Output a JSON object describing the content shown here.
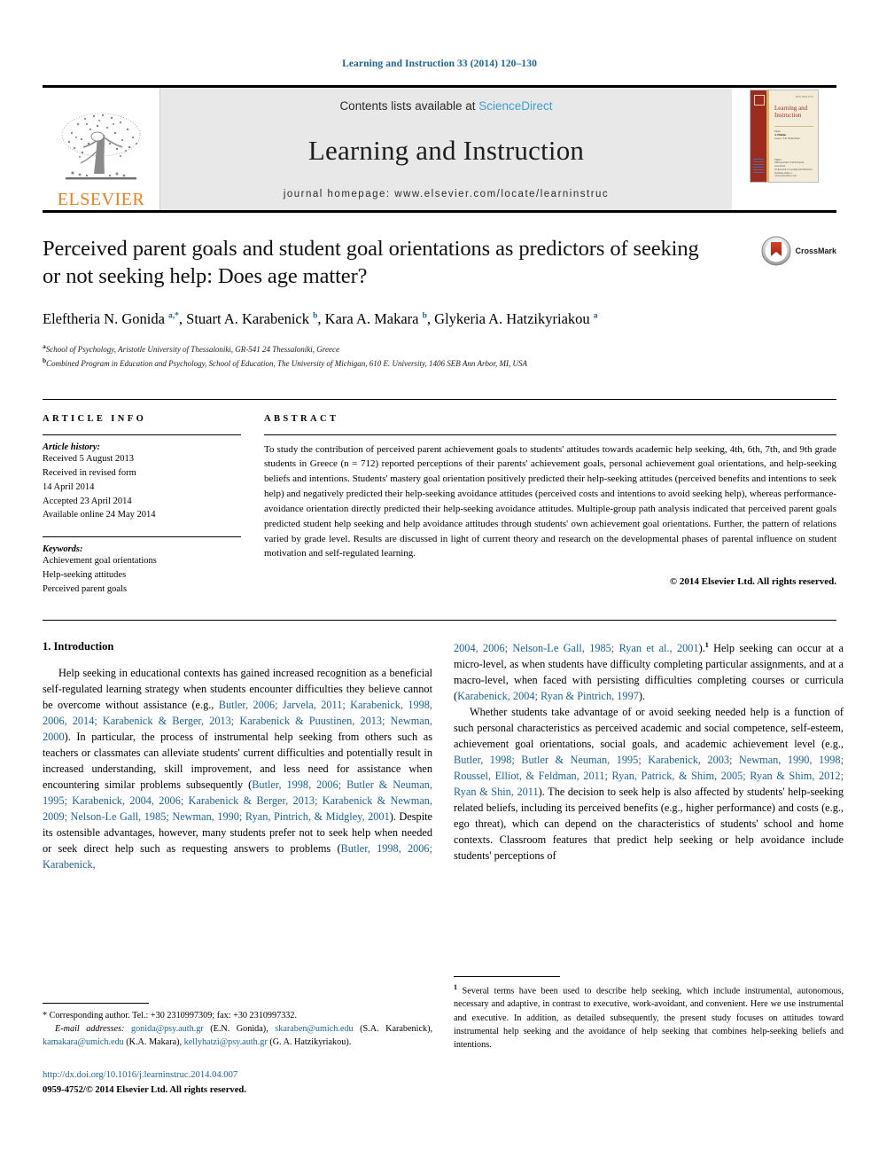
{
  "running_head": "Learning and Instruction 33 (2014) 120–130",
  "masthead": {
    "publisher_name": "ELSEVIER",
    "contents_prefix": "Contents lists available at ",
    "contents_link": "ScienceDirect",
    "journal_title": "Learning and Instruction",
    "homepage": "journal homepage: www.elsevier.com/locate/learninstruc",
    "cover": {
      "top_tiny": "ISSN 0959-4752",
      "name": "Learning and Instruction",
      "editor_label": "Editor",
      "editor_name": "A. Efklides",
      "editor_affil": "Greece / The Netherlands",
      "footer_lines": [
        "EARLI",
        "Official journal of the European Association",
        "for Research on Learning and Instruction",
        "Available online at www.sciencedirect.com"
      ]
    }
  },
  "article": {
    "title": "Perceived parent goals and student goal orientations as predictors of seeking or not seeking help: Does age matter?",
    "crossmark_label": "CrossMark",
    "authors_html": "Eleftheria N. Gonida <sup>a,*</sup>, Stuart A. Karabenick <sup>b</sup>, Kara A. Makara <sup>b</sup>, Glykeria A. Hatzikyriakou <sup>a</sup>",
    "affiliations": [
      {
        "marker": "a",
        "text": "School of Psychology, Aristotle University of Thessaloniki, GR-541 24 Thessaloniki, Greece"
      },
      {
        "marker": "b",
        "text": "Combined Program in Education and Psychology, School of Education, The University of Michigan, 610 E. University, 1406 SEB Ann Arbor, MI, USA"
      }
    ]
  },
  "article_info": {
    "heading": "ARTICLE INFO",
    "history_label": "Article history:",
    "history": [
      "Received 5 August 2013",
      "Received in revised form",
      "14 April 2014",
      "Accepted 23 April 2014",
      "Available online 24 May 2014"
    ],
    "keywords_label": "Keywords:",
    "keywords": [
      "Achievement goal orientations",
      "Help-seeking attitudes",
      "Perceived parent goals"
    ]
  },
  "abstract": {
    "heading": "ABSTRACT",
    "text": "To study the contribution of perceived parent achievement goals to students' attitudes towards academic help seeking, 4th, 6th, 7th, and 9th grade students in Greece (n = 712) reported perceptions of their parents' achievement goals, personal achievement goal orientations, and help-seeking beliefs and intentions. Students' mastery goal orientation positively predicted their help-seeking attitudes (perceived benefits and intentions to seek help) and negatively predicted their help-seeking avoidance attitudes (perceived costs and intentions to avoid seeking help), whereas performance-avoidance orientation directly predicted their help-seeking avoidance attitudes. Multiple-group path analysis indicated that perceived parent goals predicted student help seeking and help avoidance attitudes through students' own achievement goal orientations. Further, the pattern of relations varied by grade level. Results are discussed in light of current theory and research on the developmental phases of parental influence on student motivation and self-regulated learning.",
    "copyright": "© 2014 Elsevier Ltd. All rights reserved."
  },
  "body": {
    "section_heading": "1. Introduction",
    "left_p1_html": "Help seeking in educational contexts has gained increased recognition as a beneficial self-regulated learning strategy when students encounter difficulties they believe cannot be overcome without assistance (e.g., <span class=\"ref\">Butler, 2006; Jarvela, 2011; Karabenick, 1998, 2006, 2014; Karabenick &amp; Berger, 2013; Karabenick &amp; Puustinen, 2013; Newman, 2000</span>). In particular, the process of instrumental help seeking from others such as teachers or classmates can alleviate students' current difficulties and potentially result in increased understanding, skill improvement, and less need for assistance when encountering similar problems subsequently (<span class=\"ref\">Butler, 1998, 2006; Butler &amp; Neuman, 1995; Karabenick, 2004, 2006; Karabenick &amp; Berger, 2013; Karabenick &amp; Newman, 2009; Nelson-Le Gall, 1985; Newman, 1990; Ryan, Pintrich, &amp; Midgley, 2001</span>). Despite its ostensible advantages, however, many students prefer not to seek help when needed or seek direct help such as requesting answers to problems (<span class=\"ref\">Butler, 1998, 2006; Karabenick,</span>",
    "right_p1_html": "<span class=\"ref\">2004, 2006; Nelson-Le Gall, 1985; Ryan et al., 2001</span>).<sup class=\"fn\">1</sup> Help seeking can occur at a micro-level, as when students have difficulty completing particular assignments, and at a macro-level, when faced with persisting difficulties completing courses or curricula (<span class=\"ref\">Karabenick, 2004; Ryan &amp; Pintrich, 1997</span>).",
    "right_p2_html": "Whether students take advantage of or avoid seeking needed help is a function of such personal characteristics as perceived academic and social competence, self-esteem, achievement goal orientations, social goals, and academic achievement level (e.g., <span class=\"ref\">Butler, 1998; Butler &amp; Neuman, 1995; Karabenick, 2003; Newman, 1990, 1998; Roussel, Elliot, &amp; Feldman, 2011; Ryan, Patrick, &amp; Shim, 2005; Ryan &amp; Shim, 2012; Ryan &amp; Shin, 2011</span>). The decision to seek help is also affected by students' help-seeking related beliefs, including its perceived benefits (e.g., higher performance) and costs (e.g., ego threat), which can depend on the characteristics of students' school and home contexts. Classroom features that predict help seeking or help avoidance include students' perceptions of"
  },
  "footnotes": {
    "left_corresponding": "* Corresponding author. Tel.: +30 2310997309; fax: +30 2310997332.",
    "left_email_label": "E-mail addresses:",
    "left_emails_html": " <span class=\"ref\">gonida@psy.auth.gr</span> (E.N. Gonida), <span class=\"ref\">skaraben@umich.edu</span> (S.A. Karabenick), <span class=\"ref\">kamakara@umich.edu</span> (K.A. Makara), <span class=\"ref\">kellyhatzi@psy.auth.gr</span> (G. A. Hatzikyriakou).",
    "doi": "http://dx.doi.org/10.1016/j.learninstruc.2014.04.007",
    "issn": "0959-4752/© 2014 Elsevier Ltd. All rights reserved.",
    "right_marker": "1",
    "right_text": "Several terms have been used to describe help seeking, which include instrumental, autonomous, necessary and adaptive, in contrast to executive, work-avoidant, and convenient. Here we use instrumental and executive. In addition, as detailed subsequently, the present study focuses on attitudes toward instrumental help seeking and the avoidance of help seeking that combines help-seeking beliefs and intentions."
  },
  "colors": {
    "link_blue": "#1a6496",
    "sciencedirect_blue": "#3c9fd4",
    "elsevier_orange": "#ef7d1a",
    "cover_red": "#9e2b20",
    "masthead_gray": "#e8e8e8"
  }
}
